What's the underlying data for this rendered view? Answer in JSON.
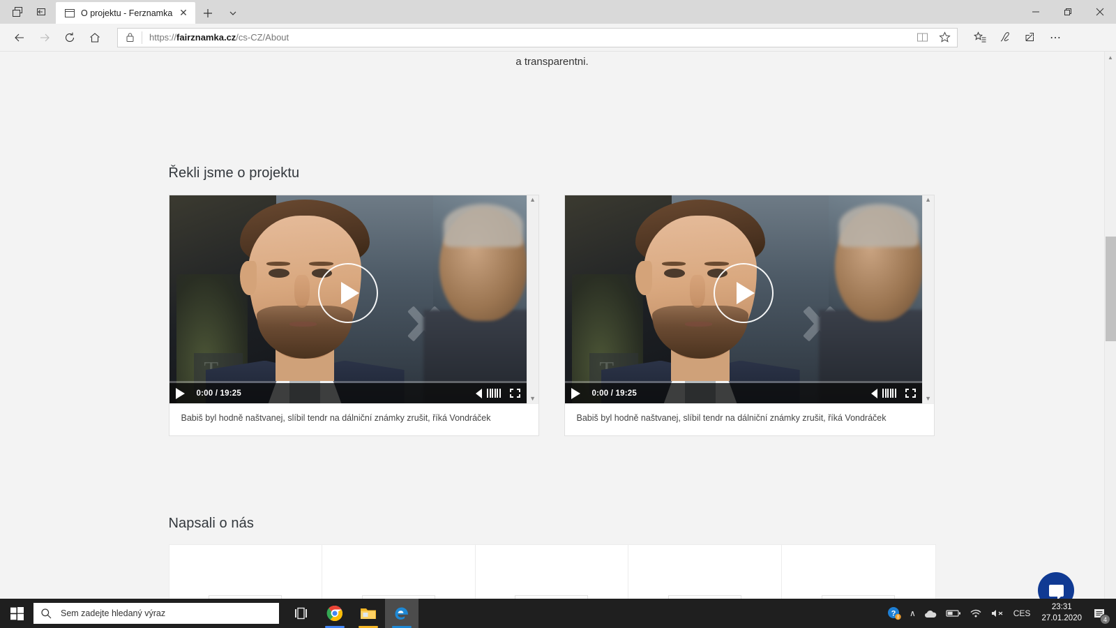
{
  "browser": {
    "tab": {
      "title": "O projektu - Ferznamka",
      "close_label": "✕"
    },
    "new_tab_label": "+",
    "tab_menu_label": "⌄",
    "window_controls": {
      "minimize": "—",
      "restore": "❐",
      "close": "✕"
    },
    "nav": {
      "back": "←",
      "forward": "→",
      "refresh": "↻",
      "home": "⌂"
    },
    "address": {
      "url_prefix": "https://",
      "url_domain": "fairznamka.cz",
      "url_path": "/cs-CZ/About",
      "full_url": "https://fairznamka.cz/cs-CZ/About",
      "lock_icon": "lock-icon",
      "reading_view_icon": "book-icon",
      "favorite_icon": "star-icon"
    },
    "toolbar_right": {
      "favorites_hub": "star-list-icon",
      "web_notes": "pen-icon",
      "share": "share-icon",
      "settings_more": "⋯"
    }
  },
  "page": {
    "top_fragment": "a transparentni.",
    "sections": {
      "videos_heading": "Řekli jsme o projektu",
      "press_heading": "Napsali o nás"
    },
    "videos": [
      {
        "current_time": "0:00",
        "separator": "/",
        "duration": "19:25",
        "time_display": "0:00 / 19:25",
        "caption": "Babiš byl hodně naštvanej, slíbil tendr na dálniční známky zrušit, říká Vondráček",
        "play_label": "play-button",
        "volume_label": "volume-icon",
        "fullscreen_label": "fullscreen-icon"
      },
      {
        "current_time": "0:00",
        "separator": "/",
        "duration": "19:25",
        "time_display": "0:00 / 19:25",
        "caption": "Babiš byl hodně naštvanej, slíbil tendr na dálniční známky zrušit, říká Vondráček",
        "play_label": "play-button",
        "volume_label": "volume-icon",
        "fullscreen_label": "fullscreen-icon"
      }
    ],
    "press_cells": [
      "",
      "",
      "",
      "",
      ""
    ],
    "chat_widget": {
      "icon": "chat-bubble-icon",
      "color": "#103a93"
    }
  },
  "taskbar": {
    "start_label": "start-button",
    "search_placeholder": "Sem zadejte hledaný výraz",
    "apps": [
      {
        "name": "task-view",
        "label": "Task View"
      },
      {
        "name": "chrome",
        "label": "Google Chrome"
      },
      {
        "name": "file-explorer",
        "label": "File Explorer"
      },
      {
        "name": "edge",
        "label": "Microsoft Edge"
      }
    ],
    "tray": {
      "help_icon": "help-icon",
      "show_hidden": "∧",
      "onedrive": "cloud-icon",
      "battery": "battery-icon",
      "network": "wifi-icon",
      "volume": "speaker-muted-icon",
      "language": "CES",
      "time": "23:31",
      "date": "27.01.2020",
      "notification_count": "4"
    }
  },
  "colors": {
    "accent": "#103a93",
    "titlebar": "#d9d9d9",
    "page_bg": "#f3f3f3",
    "taskbar": "#1f1f1f"
  }
}
